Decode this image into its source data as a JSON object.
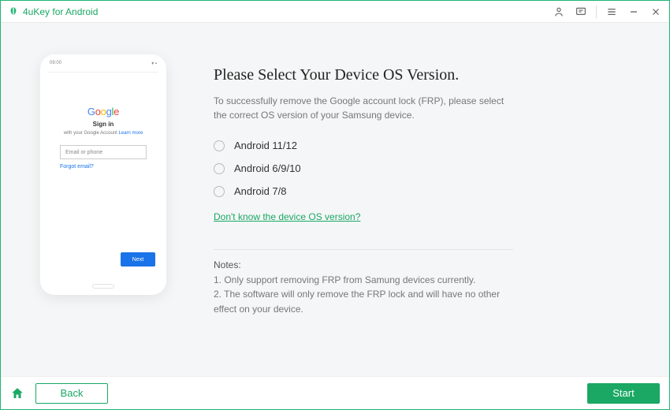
{
  "app": {
    "title": "4uKey for Android"
  },
  "phone": {
    "status_left": "09:00",
    "google_letters": [
      "G",
      "o",
      "o",
      "g",
      "l",
      "e"
    ],
    "signin": "Sign in",
    "subtext": "with your Google Account",
    "subtext_link": "Learn more",
    "input_placeholder": "Email or phone",
    "forgot": "Forgot email?",
    "next": "Next"
  },
  "panel": {
    "title": "Please Select Your Device OS Version.",
    "desc": "To successfully remove the Google account lock (FRP), please select the correct OS version of your Samsung device.",
    "options": [
      {
        "label": "Android 11/12"
      },
      {
        "label": "Android 6/9/10"
      },
      {
        "label": "Android 7/8"
      }
    ],
    "help_link": "Don't know the device OS version?",
    "notes_title": "Notes:",
    "note1": "1. Only support removing FRP from Samung devices currently.",
    "note2": "2. The software will only remove the FRP lock and will have no other effect on your device."
  },
  "footer": {
    "back": "Back",
    "start": "Start"
  }
}
